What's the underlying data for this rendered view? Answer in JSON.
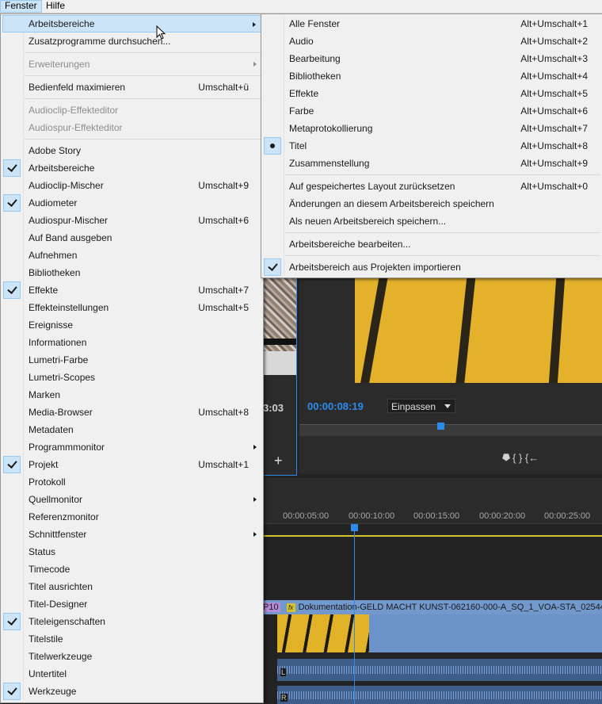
{
  "menubar": {
    "fenster": "Fenster",
    "hilfe": "Hilfe"
  },
  "main_menu": [
    {
      "label": "Arbeitsbereiche",
      "submenu": true,
      "highlighted": true
    },
    {
      "label": "Zusatzprogramme durchsuchen..."
    },
    {
      "sep": true
    },
    {
      "label": "Erweiterungen",
      "submenu": true,
      "disabled": true
    },
    {
      "sep": true
    },
    {
      "label": "Bedienfeld maximieren",
      "shortcut": "Umschalt+ü"
    },
    {
      "sep": true
    },
    {
      "label": "Audioclip-Effekteditor",
      "disabled": true
    },
    {
      "label": "Audiospur-Effekteditor",
      "disabled": true
    },
    {
      "sep": true
    },
    {
      "label": "Adobe Story"
    },
    {
      "label": "Arbeitsbereiche",
      "checked": true
    },
    {
      "label": "Audioclip-Mischer",
      "shortcut": "Umschalt+9"
    },
    {
      "label": "Audiometer",
      "checked": true
    },
    {
      "label": "Audiospur-Mischer",
      "shortcut": "Umschalt+6"
    },
    {
      "label": "Auf Band ausgeben"
    },
    {
      "label": "Aufnehmen"
    },
    {
      "label": "Bibliotheken"
    },
    {
      "label": "Effekte",
      "shortcut": "Umschalt+7",
      "checked": true
    },
    {
      "label": "Effekteinstellungen",
      "shortcut": "Umschalt+5"
    },
    {
      "label": "Ereignisse"
    },
    {
      "label": "Informationen"
    },
    {
      "label": "Lumetri-Farbe"
    },
    {
      "label": "Lumetri-Scopes"
    },
    {
      "label": "Marken"
    },
    {
      "label": "Media-Browser",
      "shortcut": "Umschalt+8"
    },
    {
      "label": "Metadaten"
    },
    {
      "label": "Programmmonitor",
      "submenu": true
    },
    {
      "label": "Projekt",
      "shortcut": "Umschalt+1",
      "checked": true
    },
    {
      "label": "Protokoll"
    },
    {
      "label": "Quellmonitor",
      "submenu": true
    },
    {
      "label": "Referenzmonitor"
    },
    {
      "label": "Schnittfenster",
      "submenu": true
    },
    {
      "label": "Status"
    },
    {
      "label": "Timecode"
    },
    {
      "label": "Titel ausrichten"
    },
    {
      "label": "Titel-Designer"
    },
    {
      "label": "Titeleigenschaften",
      "checked": true
    },
    {
      "label": "Titelstile"
    },
    {
      "label": "Titelwerkzeuge"
    },
    {
      "label": "Untertitel"
    },
    {
      "label": "Werkzeuge",
      "checked": true
    }
  ],
  "sub_menu": [
    {
      "label": "Alle Fenster",
      "shortcut": "Alt+Umschalt+1"
    },
    {
      "label": "Audio",
      "shortcut": "Alt+Umschalt+2"
    },
    {
      "label": "Bearbeitung",
      "shortcut": "Alt+Umschalt+3"
    },
    {
      "label": "Bibliotheken",
      "shortcut": "Alt+Umschalt+4"
    },
    {
      "label": "Effekte",
      "shortcut": "Alt+Umschalt+5"
    },
    {
      "label": "Farbe",
      "shortcut": "Alt+Umschalt+6"
    },
    {
      "label": "Metaprotokollierung",
      "shortcut": "Alt+Umschalt+7"
    },
    {
      "label": "Titel",
      "shortcut": "Alt+Umschalt+8",
      "radio": true
    },
    {
      "label": "Zusammenstellung",
      "shortcut": "Alt+Umschalt+9"
    },
    {
      "sep": true
    },
    {
      "label": "Auf gespeichertes Layout zurücksetzen",
      "shortcut": "Alt+Umschalt+0"
    },
    {
      "label": "Änderungen an diesem Arbeitsbereich speichern"
    },
    {
      "label": "Als neuen Arbeitsbereich speichern..."
    },
    {
      "sep": true
    },
    {
      "label": "Arbeitsbereiche bearbeiten..."
    },
    {
      "sep": true
    },
    {
      "label": "Arbeitsbereich aus Projekten importieren",
      "checked": true
    }
  ],
  "source": {
    "timecode": "3:03",
    "add": "+"
  },
  "program": {
    "timecode": "00:00:08:19",
    "fit": "Einpassen",
    "controls": "⯂   {   }   {←"
  },
  "timeline": {
    "ticks": [
      "00:00:05:00",
      "00:00:10:00",
      "00:00:15:00",
      "00:00:20:00",
      "00:00:25:00"
    ],
    "clip_tag": "P10",
    "clip_title": "Dokumentation-GELD MACHT KUNST-062160-000-A_SQ_1_VOA-STA_02544",
    "fx": "fx",
    "audio_l": "L",
    "audio_r": "R"
  },
  "colors": {
    "accent": "#2d8ceb",
    "highlight": "#cce4f7",
    "menu_bg": "#f0f0f0",
    "clip_video": "#6c93c9",
    "clip_audio": "#3e5d88"
  }
}
